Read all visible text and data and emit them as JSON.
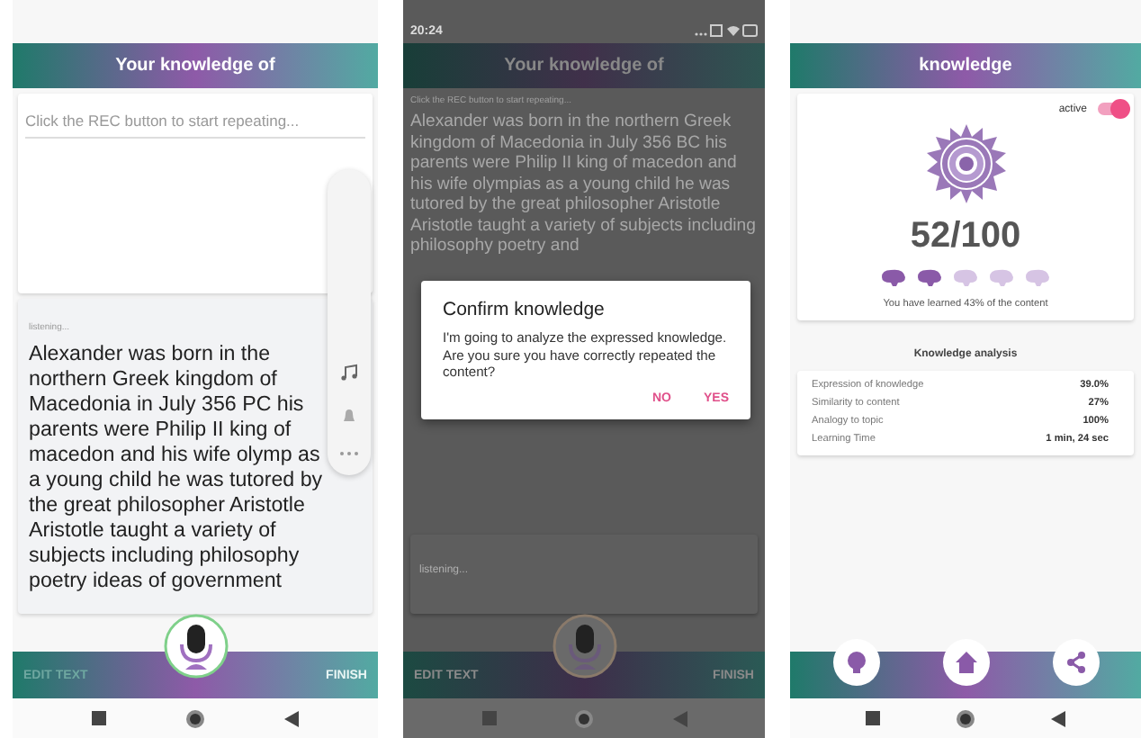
{
  "repeat_screen": {
    "title": "Your knowledge of",
    "placeholder": "Click the REC button to start repeating...",
    "status": "listening...",
    "transcript": "Alexander was born in the northern Greek kingdom of Macedonia in July 356 PC his parents were Philip II king of macedon and his wife olymp as a young child he was tutored by the great philosopher Aristotle Aristotle taught a variety of subjects including philosophy poetry ideas of government",
    "bottom_left": "EDIT TEXT",
    "bottom_right": "FINISH"
  },
  "confirm_screen": {
    "time": "20:24",
    "title": "Your knowledge of",
    "hint": "Click the REC button to start repeating...",
    "text": "Alexander was born in the northern Greek kingdom of Macedonia in July 356 BC his parents were Philip II king of macedon and his wife olympias as a young child he was tutored by the great philosopher Aristotle Aristotle taught a variety of subjects including philosophy poetry and",
    "status": "listening...",
    "dialog": {
      "title": "Confirm knowledge",
      "message": "I'm going to analyze the expressed knowledge.\nAre you sure you have correctly repeated the content?",
      "buttons": [
        "NO",
        "YES"
      ]
    },
    "bottom_left": "EDIT TEXT",
    "bottom_right": "FINISH"
  },
  "result_screen": {
    "title": "knowledge",
    "toggle": {
      "label": "active",
      "on": true
    },
    "score": "52/100",
    "stars": 2,
    "summary": "You have learned 43% of the content",
    "section_title": "Knowledge analysis",
    "rows": [
      {
        "label": "Expression of knowledge",
        "value": "39.0%"
      },
      {
        "label": "Similarity to content",
        "value": "27%"
      },
      {
        "label": "Analogy to topic",
        "value": "100%"
      },
      {
        "label": "Learning Time",
        "value": "1 min, 24 sec"
      }
    ]
  }
}
